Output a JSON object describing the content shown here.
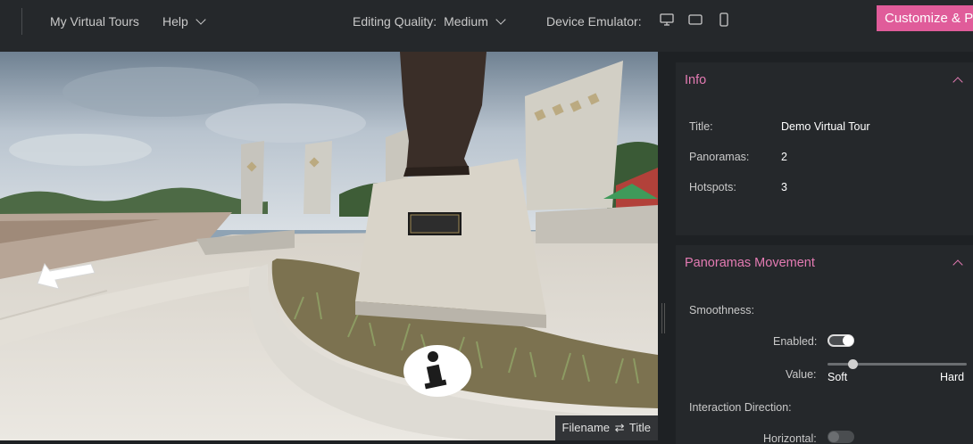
{
  "topbar": {
    "my_tours": "My Virtual Tours",
    "help": "Help",
    "quality_label": "Editing Quality:",
    "quality_value": "Medium",
    "emulator_label": "Device Emulator:",
    "customize": "Customize & P"
  },
  "viewer": {
    "filename": "Filename",
    "swap": "⇄",
    "title": "Title"
  },
  "info": {
    "heading": "Info",
    "rows": [
      {
        "label": "Title:",
        "value": "Demo Virtual Tour"
      },
      {
        "label": "Panoramas:",
        "value": "2"
      },
      {
        "label": "Hotspots:",
        "value": "3"
      }
    ]
  },
  "movement": {
    "heading": "Panoramas Movement",
    "smoothness": "Smoothness:",
    "enabled_label": "Enabled:",
    "enabled": true,
    "value_label": "Value:",
    "value_fraction": 0.18,
    "soft": "Soft",
    "hard": "Hard",
    "direction": "Interaction Direction:",
    "horizontal_label": "Horizontal:",
    "horizontal": false
  },
  "colors": {
    "accent": "#e05c9a",
    "heading": "#e47bb3",
    "panel": "#25282b",
    "background": "#1e2124"
  }
}
